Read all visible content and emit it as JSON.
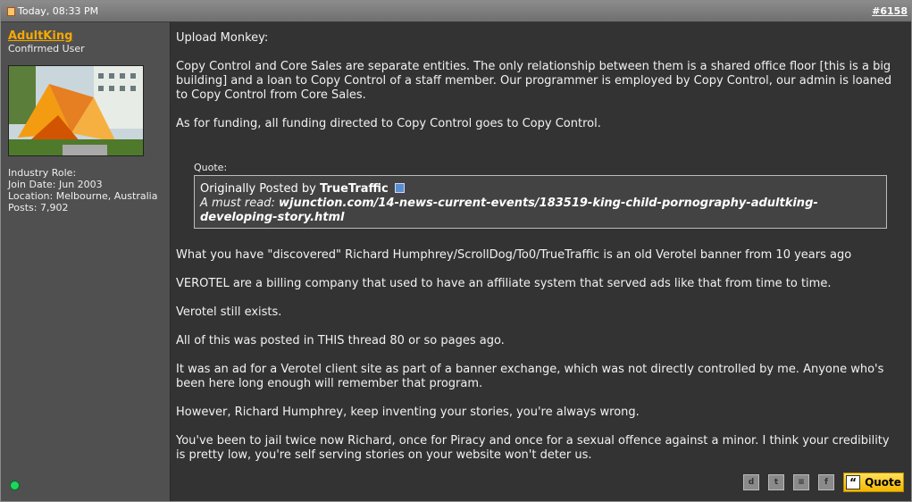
{
  "header": {
    "date": "Today, 08:33 PM",
    "post_number": "#6158"
  },
  "user": {
    "name": "AdultKing",
    "title": "Confirmed User",
    "info": [
      "Industry Role:",
      "Join Date: Jun 2003",
      "Location: Melbourne, Australia",
      "Posts: 7,902"
    ]
  },
  "content": {
    "intro": "Upload Monkey:",
    "p1": "Copy Control and Core Sales are separate entities. The only relationship between them is a shared office floor [this is a big building] and a loan to Copy Control of a staff member. Our programmer is employed by Copy Control, our admin is loaned to Copy Control from Core Sales.",
    "p2": "As for funding, all funding directed to Copy Control goes to Copy Control.",
    "quote_label": "Quote:",
    "quote_by_prefix": "Originally Posted by",
    "quote_author": "TrueTraffic",
    "quote_text_prefix": "A must read:",
    "quote_link": "wjunction.com/14-news-current-events/183519-king-child-pornography-adultking-developing-story.html",
    "p3": "What you have \"discovered\" Richard Humphrey/ScrollDog/To0/TrueTraffic is an old Verotel banner from 10 years ago",
    "p4": "VEROTEL are a billing company that used to have an affiliate system that served ads like that from time to time.",
    "p5": "Verotel still exists.",
    "p6": "All of this was posted in THIS thread 80 or so pages ago.",
    "p7": "It was an ad for a Verotel client site as part of a banner exchange, which was not directly controlled by me. Anyone who's been here long enough will remember that program.",
    "p8": "However, Richard Humphrey, keep inventing your stories, you're always wrong.",
    "p9": "You've been to jail twice now Richard, once for Piracy and once for a sexual offence against a minor. I think your credibility is pretty low, you're self serving stories on your website won't deter us."
  },
  "footer": {
    "quote_button": "Quote",
    "share_icons": [
      "digg-icon",
      "twitter-icon",
      "delicious-icon",
      "facebook-icon"
    ]
  },
  "colors": {
    "username": "#f6a800",
    "quote_button": "#f3b700",
    "online": "#1ed760"
  }
}
